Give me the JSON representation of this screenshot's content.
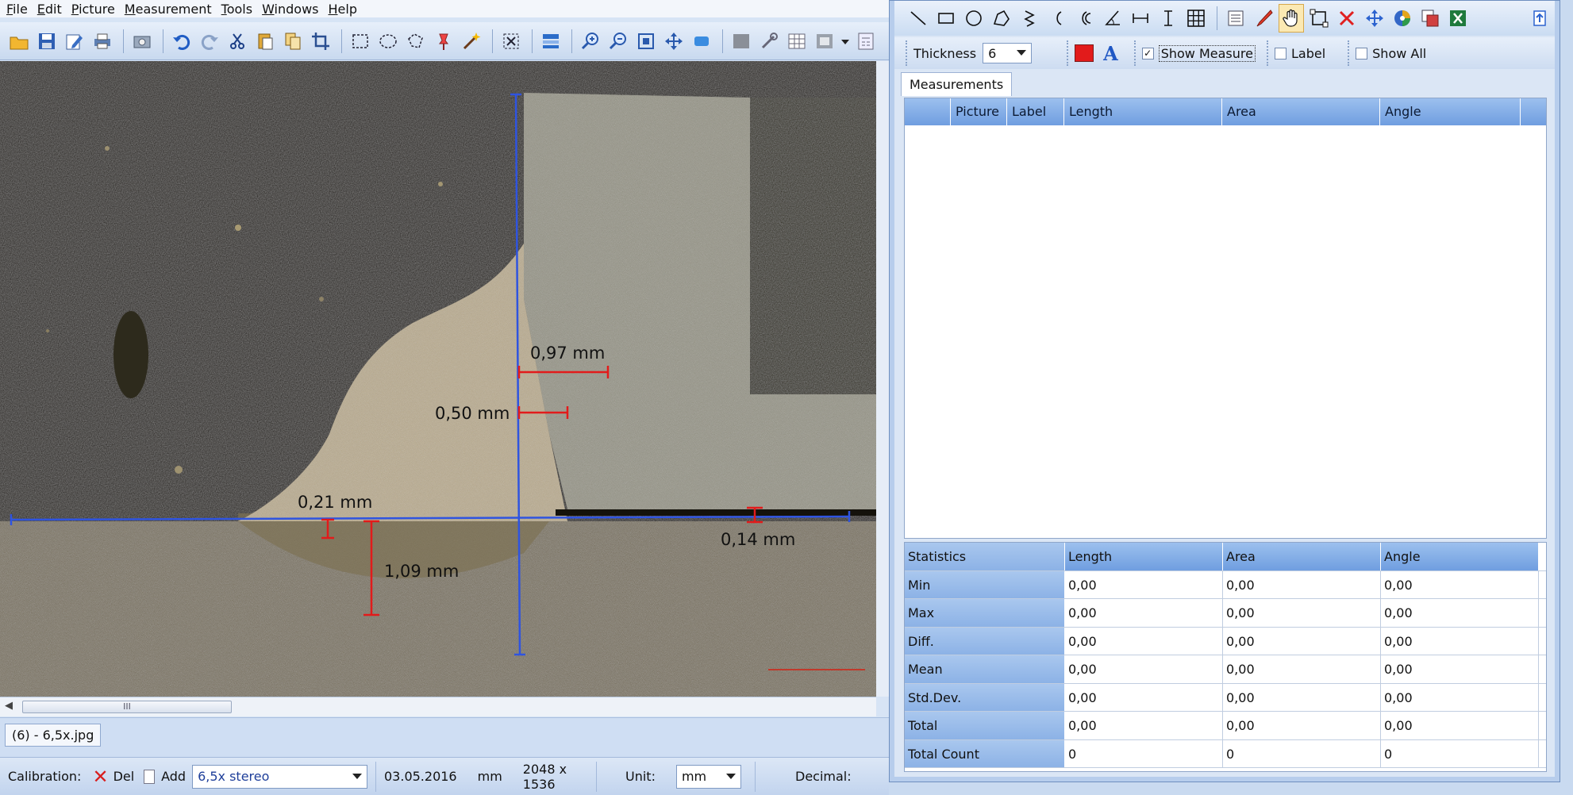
{
  "menu": {
    "items": [
      "File",
      "Edit",
      "Picture",
      "Measurement",
      "Tools",
      "Windows",
      "Help"
    ]
  },
  "image": {
    "measurements": [
      {
        "label": "0,97 mm"
      },
      {
        "label": "0,50 mm"
      },
      {
        "label": "0,21 mm"
      },
      {
        "label": "1,09 mm"
      },
      {
        "label": "0,14 mm"
      }
    ]
  },
  "scrollbar": {
    "thumb_grip": "III"
  },
  "image_tab": {
    "label": "(6) - 6,5x.jpg"
  },
  "status_bar": {
    "calibration_label": "Calibration:",
    "del_label": "Del",
    "add_label": "Add",
    "calibration_value": "6,5x stereo",
    "date": "03.05.2016",
    "unit_short": "mm",
    "resolution": "2048 x 1536",
    "unit_label": "Unit:",
    "unit_value": "mm",
    "decimal_label": "Decimal:"
  },
  "options": {
    "thickness_label": "Thickness",
    "thickness_value": "6",
    "show_measure_label": "Show Measure",
    "show_measure_checked": "✓",
    "label_label": "Label",
    "show_all_label": "Show All",
    "font_glyph": "A",
    "line_color": "#e21b1b"
  },
  "tabs": {
    "measurements": "Measurements"
  },
  "measurements_table": {
    "columns": [
      "",
      "Picture",
      "Label",
      "Length",
      "Area",
      "Angle"
    ]
  },
  "statistics": {
    "header": [
      "Statistics",
      "Length",
      "Area",
      "Angle"
    ],
    "rows": [
      {
        "label": "Min",
        "length": "0,00",
        "area": "0,00",
        "angle": "0,00"
      },
      {
        "label": "Max",
        "length": "0,00",
        "area": "0,00",
        "angle": "0,00"
      },
      {
        "label": "Diff.",
        "length": "0,00",
        "area": "0,00",
        "angle": "0,00"
      },
      {
        "label": "Mean",
        "length": "0,00",
        "area": "0,00",
        "angle": "0,00"
      },
      {
        "label": "Std.Dev.",
        "length": "0,00",
        "area": "0,00",
        "angle": "0,00"
      },
      {
        "label": "Total",
        "length": "0,00",
        "area": "0,00",
        "angle": "0,00"
      },
      {
        "label": "Total Count",
        "length": "0",
        "area": "0",
        "angle": "0"
      }
    ]
  },
  "icons": {
    "main_toolbar": [
      "open-icon",
      "save-icon",
      "edit-icon",
      "print-icon",
      "camera-icon",
      "undo-icon",
      "redo-icon",
      "cut-icon",
      "paste-icon",
      "copy-icon",
      "crop-icon",
      "rect-select-icon",
      "ellipse-select-icon",
      "lasso-icon",
      "pin-select-icon",
      "magic-wand-icon",
      "deselect-icon",
      "layers-icon",
      "zoom-in-icon",
      "zoom-out-icon",
      "fit-icon",
      "pan-icon",
      "actual-size-icon",
      "gray-box-icon",
      "tools-icon",
      "grid-icon",
      "frame-icon",
      "dropdown-icon",
      "calc-icon"
    ],
    "measure_toolbar": [
      "line-icon",
      "rectangle-icon",
      "circle-icon",
      "polygon-icon",
      "polyline-icon",
      "arc-icon",
      "double-arc-icon",
      "angle-icon",
      "horizontal-distance-icon",
      "vertical-distance-icon",
      "grid-icon",
      "note-icon",
      "pointer-icon",
      "hand-icon",
      "transform-icon",
      "delete-icon",
      "move-icon",
      "color-wheel-icon",
      "export-icon",
      "excel-icon"
    ]
  }
}
